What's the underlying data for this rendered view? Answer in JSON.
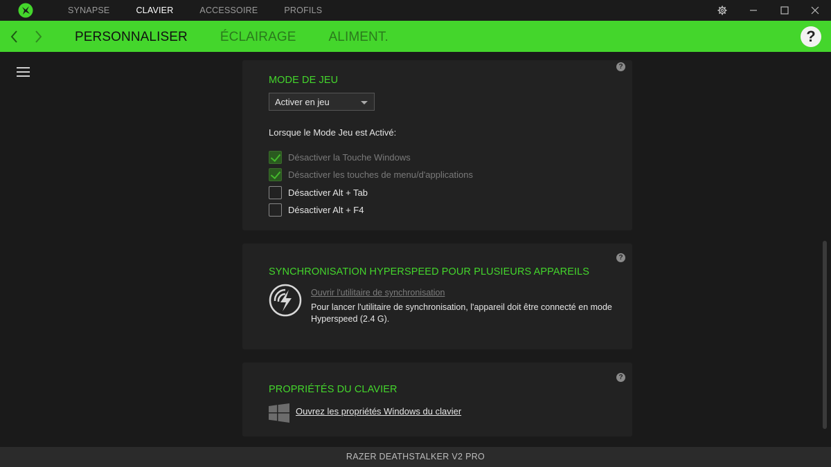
{
  "topnav": {
    "tabs": [
      {
        "label": "SYNAPSE",
        "active": false
      },
      {
        "label": "CLAVIER",
        "active": true
      },
      {
        "label": "ACCESSOIRE",
        "active": false
      },
      {
        "label": "PROFILS",
        "active": false
      }
    ]
  },
  "subnav": {
    "tabs": [
      {
        "label": "PERSONNALISER",
        "active": true
      },
      {
        "label": "ÉCLAIRAGE",
        "active": false
      },
      {
        "label": "ALIMENT.",
        "active": false
      }
    ],
    "help": "?"
  },
  "game_mode": {
    "title": "MODE DE JEU",
    "dropdown_value": "Activer en jeu",
    "intro": "Lorsque le Mode Jeu est Activé:",
    "options": [
      {
        "label": "Désactiver la Touche Windows",
        "checked": true,
        "disabled": true
      },
      {
        "label": "Désactiver les touches de menu/d'applications",
        "checked": true,
        "disabled": true
      },
      {
        "label": "Désactiver Alt + Tab",
        "checked": false,
        "disabled": false
      },
      {
        "label": "Désactiver Alt + F4",
        "checked": false,
        "disabled": false
      }
    ]
  },
  "hyperspeed": {
    "title": "SYNCHRONISATION HYPERSPEED POUR PLUSIEURS APPAREILS",
    "link": "Ouvrir l'utilitaire de synchronisation",
    "description": "Pour lancer l'utilitaire de synchronisation, l'appareil doit être connecté en mode Hyperspeed (2.4 G)."
  },
  "keyboard_props": {
    "title": "PROPRIÉTÉS DU CLAVIER",
    "link": "Ouvrez les propriétés Windows du clavier"
  },
  "panel_help": "?",
  "status": {
    "device": "RAZER DEATHSTALKER V2 PRO"
  },
  "colors": {
    "accent": "#44d62c",
    "background": "#1a1a1a",
    "panel": "#222222"
  }
}
